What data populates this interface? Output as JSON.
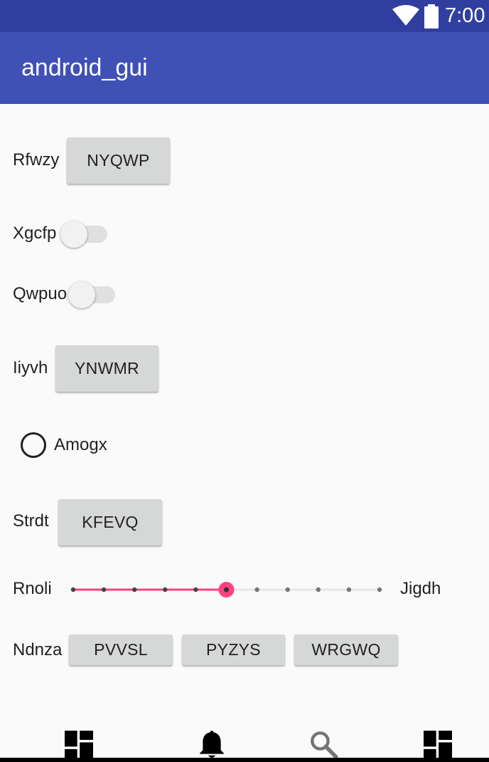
{
  "status_bar": {
    "time": "7:00",
    "icons": [
      "wifi-icon",
      "battery-icon"
    ]
  },
  "app_bar": {
    "title": "android_gui"
  },
  "rows": {
    "row1": {
      "label": "Rfwzy",
      "button": "NYQWP"
    },
    "row2": {
      "label": "Xgcfp",
      "switch_on": false
    },
    "row3": {
      "label": "Qwpuo",
      "switch_on": false
    },
    "row4": {
      "label": "Iiyvh",
      "button": "YNWMR"
    },
    "row5": {
      "radio_label": "Amogx",
      "checked": false
    },
    "row6": {
      "label": "Strdt",
      "button": "KFEVQ"
    },
    "row7": {
      "label": "Rnoli",
      "end_label": "Jigdh",
      "seek_value": 5,
      "seek_max": 10
    },
    "row8": {
      "label": "Ndnza",
      "buttons": [
        "PVVSL",
        "PYZYS",
        "WRGWQ"
      ]
    }
  },
  "colors": {
    "status_bar": "#303F9F",
    "app_bar": "#3F51B5",
    "accent": "#FF4081",
    "button_bg": "#D6D7D7"
  },
  "bottom_nav": {
    "icons": [
      "dashboard-icon",
      "notifications-icon",
      "search-icon",
      "dashboard-icon"
    ]
  }
}
